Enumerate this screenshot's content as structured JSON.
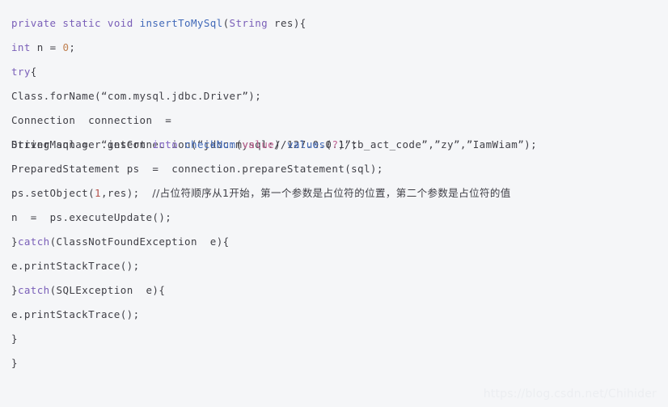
{
  "editor": {
    "background_color": "#f5f6f8",
    "default_text_color": "#3f3f46",
    "language": "java"
  },
  "colors": {
    "keyword": "#7a5fb8",
    "keyword_alt": "#8d6fd0",
    "function": "#4169b8",
    "number": "#c08050",
    "number_red": "#b5504a",
    "sql_value": "#c06090",
    "comment": "#3f3f46",
    "watermark": "#eceef1"
  },
  "code": {
    "line_01": {
      "kw_private": "private",
      "kw_static": "static",
      "kw_void": "void",
      "fn_name": "insertToMySql",
      "paren_open": "(",
      "type_string": "String",
      "param_res": "res",
      "tail": "){"
    },
    "line_02": {
      "kw_int": "int",
      "var_n": "n",
      "eq": "=",
      "num_zero": "0",
      "semi": ";"
    },
    "line_03": {
      "kw_try": "try",
      "brace": "{"
    },
    "line_04": {
      "call": "Class.forName(",
      "quote_open": "“",
      "string": "com.mysql.jdbc.Driver",
      "quote_close": "”",
      "tail": ");"
    },
    "line_05": {
      "type": "Connection",
      "var": "connection",
      "eq": "=",
      "call": "DriverMannager.getConnection(",
      "q1o": "“",
      "url": "jdbc:mysql://127.0.0.1/tb_act_code",
      "q1c": "”",
      "c1": ",",
      "q2o": "”",
      "user": "zy",
      "q2c": "”",
      "c2": ",",
      "q3o": "”",
      "password": "IamWiam",
      "q3c": "”",
      "tail": ");"
    },
    "line_06": {
      "type": "String",
      "var": "sql",
      "eq": "=",
      "quote_open": "“",
      "sql_insert": "insert",
      "sql_into": "into",
      "sql_table": "checkNum",
      "sql_paren_open": "(",
      "sql_column": "value",
      "sql_paren_close": ")",
      "sql_values": "values",
      "sql_vparen_open": "(",
      "sql_placeholder": "?",
      "sql_vparen_close": ")",
      "quote_close": "”",
      "tail": ";"
    },
    "line_07": {
      "type": "PreparedStatement",
      "var": "ps",
      "eq": "=",
      "call": "connection.prepareStatement(sql);"
    },
    "line_08": {
      "call_open": "ps.setObject(",
      "arg_index": "1",
      "comma": ",",
      "arg_res": "res",
      "call_close": ");",
      "comment": "//占位符顺序从1开始，第一个参数是占位符的位置，第二个参数是占位符的值"
    },
    "line_09": {
      "var": "n",
      "eq": "=",
      "call": "ps.executeUpdate();"
    },
    "line_10": {
      "brace_close": "}",
      "kw_catch": "catch",
      "paren_open": "(",
      "exception": "ClassNotFoundException",
      "var": "e",
      "tail": "){"
    },
    "line_11": {
      "call": "e.printStackTrace();"
    },
    "line_12": {
      "brace_close": "}",
      "kw_catch": "catch",
      "paren_open": "(",
      "exception": "SQLException",
      "var": "e",
      "tail": "){"
    },
    "line_13": {
      "call": "e.printStackTrace();"
    },
    "line_14": {
      "brace_close": "}"
    },
    "line_15": {
      "brace_close": "}"
    }
  },
  "watermark": {
    "text": "https://blog.csdn.net/Chihider"
  }
}
